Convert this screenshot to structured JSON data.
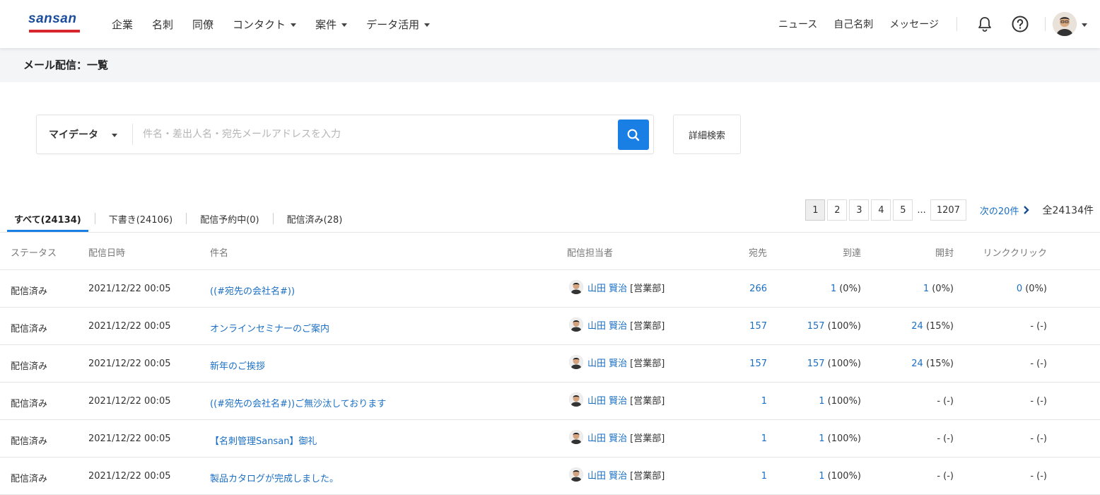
{
  "header": {
    "logo_text": "sansan",
    "nav": [
      {
        "label": "企業",
        "dropdown": false
      },
      {
        "label": "名刺",
        "dropdown": false
      },
      {
        "label": "同僚",
        "dropdown": false
      },
      {
        "label": "コンタクト",
        "dropdown": true
      },
      {
        "label": "案件",
        "dropdown": true
      },
      {
        "label": "データ活用",
        "dropdown": true
      }
    ],
    "right_links": [
      "ニュース",
      "自己名刺",
      "メッセージ"
    ],
    "icons": [
      "bell-icon",
      "help-icon",
      "avatar"
    ]
  },
  "page": {
    "title": "メール配信：一覧"
  },
  "search": {
    "scope": "マイデータ",
    "placeholder": "件名・差出人名・宛先メールアドレスを入力",
    "value": "",
    "advanced_label": "詳細検索"
  },
  "tabs": [
    {
      "label": "すべて(24134)",
      "active": true
    },
    {
      "label": "下書き(24106)",
      "active": false
    },
    {
      "label": "配信予約中(0)",
      "active": false
    },
    {
      "label": "配信済み(28)",
      "active": false
    }
  ],
  "pagination": {
    "pages": [
      "1",
      "2",
      "3",
      "4",
      "5"
    ],
    "current": "1",
    "ellipsis": "...",
    "last": "1207",
    "next_label": "次の20件",
    "total": "全24134件"
  },
  "table": {
    "headers": {
      "status": "ステータス",
      "date": "配信日時",
      "subject": "件名",
      "owner": "配信担当者",
      "to": "宛先",
      "reach": "到達",
      "open": "開封",
      "click": "リンククリック"
    },
    "rows": [
      {
        "status": "配信済み",
        "date": "2021/12/22 00:05",
        "subject": "((#宛先の会社名#))",
        "owner": "山田 賢治",
        "dept": "[営業部]",
        "to": "266",
        "reach_n": "1",
        "reach_p": " (0%)",
        "open_n": "1",
        "open_p": " (0%)",
        "click_n": "0",
        "click_p": " (0%)"
      },
      {
        "status": "配信済み",
        "date": "2021/12/22 00:05",
        "subject": "オンラインセミナーのご案内",
        "owner": "山田 賢治",
        "dept": "[営業部]",
        "to": "157",
        "reach_n": "157",
        "reach_p": " (100%)",
        "open_n": "24",
        "open_p": " (15%)",
        "click_n": "",
        "click_p": "- (-)"
      },
      {
        "status": "配信済み",
        "date": "2021/12/22 00:05",
        "subject": "新年のご挨拶",
        "owner": "山田 賢治",
        "dept": "[営業部]",
        "to": "157",
        "reach_n": "157",
        "reach_p": " (100%)",
        "open_n": "24",
        "open_p": " (15%)",
        "click_n": "",
        "click_p": "- (-)"
      },
      {
        "status": "配信済み",
        "date": "2021/12/22 00:05",
        "subject": "((#宛先の会社名#))ご無沙汰しております",
        "owner": "山田 賢治",
        "dept": "[営業部]",
        "to": "1",
        "reach_n": "1",
        "reach_p": " (100%)",
        "open_n": "",
        "open_p": "- (-)",
        "click_n": "",
        "click_p": "- (-)"
      },
      {
        "status": "配信済み",
        "date": "2021/12/22 00:05",
        "subject": "【名刺管理Sansan】御礼",
        "owner": "山田 賢治",
        "dept": "[営業部]",
        "to": "1",
        "reach_n": "1",
        "reach_p": " (100%)",
        "open_n": "",
        "open_p": "- (-)",
        "click_n": "",
        "click_p": "- (-)"
      },
      {
        "status": "配信済み",
        "date": "2021/12/22 00:05",
        "subject": "製品カタログが完成しました。",
        "owner": "山田 賢治",
        "dept": "[営業部]",
        "to": "1",
        "reach_n": "1",
        "reach_p": " (100%)",
        "open_n": "",
        "open_p": "- (-)",
        "click_n": "",
        "click_p": "- (-)"
      }
    ]
  },
  "colors": {
    "brand_blue": "#1b4d9b",
    "brand_red": "#d7262d",
    "accent": "#1a7fe5",
    "link": "#1a6fc4"
  }
}
